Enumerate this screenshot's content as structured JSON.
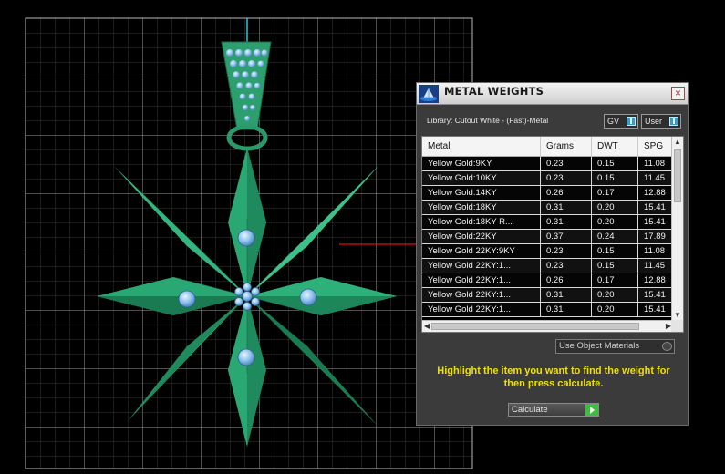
{
  "panel": {
    "title": "METAL WEIGHTS",
    "close_label": "×",
    "library_label": "Library: Cutout White - (Fast)-Metal",
    "gv_toggle": "GV",
    "user_toggle": "User",
    "columns": [
      "Metal",
      "Grams",
      "DWT",
      "SPG"
    ],
    "rows": [
      {
        "metal": "Yellow Gold:9KY",
        "grams": "0.23",
        "dwt": "0.15",
        "spg": "11.08"
      },
      {
        "metal": "Yellow Gold:10KY",
        "grams": "0.23",
        "dwt": "0.15",
        "spg": "11.45"
      },
      {
        "metal": "Yellow Gold:14KY",
        "grams": "0.26",
        "dwt": "0.17",
        "spg": "12.88"
      },
      {
        "metal": "Yellow Gold:18KY",
        "grams": "0.31",
        "dwt": "0.20",
        "spg": "15.41"
      },
      {
        "metal": "Yellow Gold:18KY R...",
        "grams": "0.31",
        "dwt": "0.20",
        "spg": "15.41"
      },
      {
        "metal": "Yellow Gold:22KY",
        "grams": "0.37",
        "dwt": "0.24",
        "spg": "17.89"
      },
      {
        "metal": "Yellow Gold 22KY:9KY",
        "grams": "0.23",
        "dwt": "0.15",
        "spg": "11.08"
      },
      {
        "metal": "Yellow Gold 22KY:1...",
        "grams": "0.23",
        "dwt": "0.15",
        "spg": "11.45"
      },
      {
        "metal": "Yellow Gold 22KY:1...",
        "grams": "0.26",
        "dwt": "0.17",
        "spg": "12.88"
      },
      {
        "metal": "Yellow Gold 22KY:1...",
        "grams": "0.31",
        "dwt": "0.20",
        "spg": "15.41"
      },
      {
        "metal": "Yellow Gold 22KY:1...",
        "grams": "0.31",
        "dwt": "0.20",
        "spg": "15.41"
      }
    ],
    "use_object_materials": "Use Object Materials",
    "instruction": "Highlight the item you want to find the weight for then press calculate.",
    "calculate_label": "Calculate"
  },
  "colors": {
    "gem_green": "#2a9a6c",
    "grid": "#d0d0d0",
    "instruction_yellow": "#f0e000"
  }
}
